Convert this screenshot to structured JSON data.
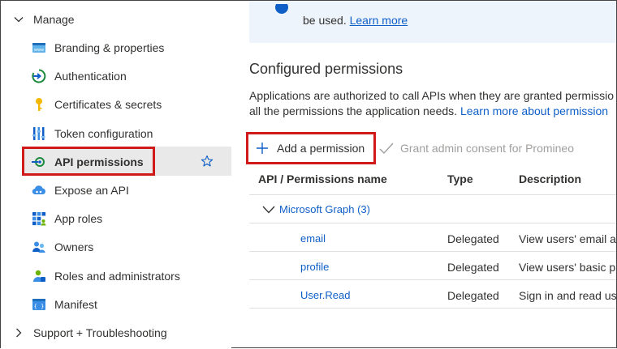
{
  "sidebar": {
    "manage_label": "Manage",
    "items": [
      {
        "label": "Branding & properties",
        "icon": "branding-icon"
      },
      {
        "label": "Authentication",
        "icon": "authentication-icon"
      },
      {
        "label": "Certificates & secrets",
        "icon": "key-icon"
      },
      {
        "label": "Token configuration",
        "icon": "token-icon"
      },
      {
        "label": "API permissions",
        "icon": "api-permissions-icon",
        "selected": true
      },
      {
        "label": "Expose an API",
        "icon": "cloud-icon"
      },
      {
        "label": "App roles",
        "icon": "app-roles-icon"
      },
      {
        "label": "Owners",
        "icon": "owners-icon"
      },
      {
        "label": "Roles and administrators",
        "icon": "roles-icon"
      },
      {
        "label": "Manifest",
        "icon": "manifest-icon"
      }
    ],
    "support_label": "Support + Troubleshooting"
  },
  "main": {
    "banner": {
      "text": "be used.",
      "link": "Learn more"
    },
    "title": "Configured permissions",
    "description": {
      "line1": "Applications are authorized to call APIs when they are granted permissio",
      "line2": "all the permissions the application needs.",
      "link": "Learn more about permission"
    },
    "toolbar": {
      "add_label": "Add a permission",
      "grant_label": "Grant admin consent for Promineo"
    },
    "table": {
      "headers": [
        "API / Permissions name",
        "Type",
        "Description"
      ],
      "group": "Microsoft Graph (3)",
      "rows": [
        {
          "name": "email",
          "type": "Delegated",
          "description": "View users' email a"
        },
        {
          "name": "profile",
          "type": "Delegated",
          "description": "View users' basic p"
        },
        {
          "name": "User.Read",
          "type": "Delegated",
          "description": "Sign in and read us"
        }
      ]
    }
  },
  "colors": {
    "accent": "#0f5fc7",
    "highlight_box": "#d01a1a",
    "selected_bg": "#e9e9e9"
  }
}
